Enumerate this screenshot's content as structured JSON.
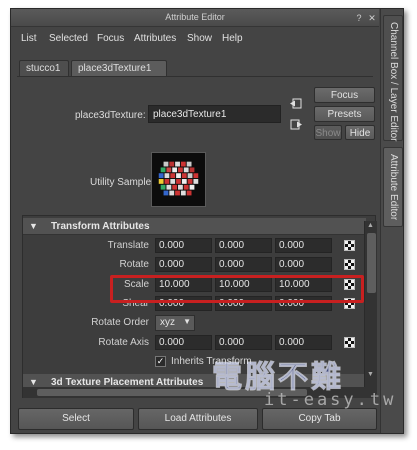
{
  "window": {
    "title": "Attribute Editor",
    "controls": [
      "?",
      "✕"
    ],
    "docked_tabs": [
      "Channel Box / Layer Editor",
      "Attribute Editor"
    ]
  },
  "menubar": [
    "List",
    "Selected",
    "Focus",
    "Attributes",
    "Show",
    "Help"
  ],
  "tabs": [
    "stucco1",
    "place3dTexture1"
  ],
  "node": {
    "label": "place3dTexture:",
    "value": "place3dTexture1",
    "buttons": {
      "focus": "Focus",
      "presets": "Presets",
      "show": "Show",
      "hide": "Hide"
    }
  },
  "swatch": {
    "label": "Utility Sample"
  },
  "sections": {
    "transform": {
      "title": "Transform Attributes",
      "translate": {
        "label": "Translate",
        "values": [
          "0.000",
          "0.000",
          "0.000"
        ]
      },
      "rotate": {
        "label": "Rotate",
        "values": [
          "0.000",
          "0.000",
          "0.000"
        ]
      },
      "scale": {
        "label": "Scale",
        "values": [
          "10.000",
          "10.000",
          "10.000"
        ]
      },
      "shear": {
        "label": "Shear",
        "values": [
          "0.000",
          "0.000",
          "0.000"
        ]
      },
      "rotate_order": {
        "label": "Rotate Order",
        "value": "xyz"
      },
      "rotate_axis": {
        "label": "Rotate Axis",
        "values": [
          "0.000",
          "0.000",
          "0.000"
        ]
      },
      "inherits_transform": {
        "label": "Inherits Transform",
        "checked": true
      }
    },
    "placement": {
      "title": "3d Texture Placement Attributes"
    }
  },
  "bottom_buttons": [
    "Select",
    "Load Attributes",
    "Copy Tab"
  ],
  "watermark": {
    "main": "電腦不難",
    "sub": "it-easy.tw"
  },
  "colors": {
    "highlight": "#c82020",
    "panel_bg": "#444444",
    "field_bg": "#2b2b2b"
  }
}
